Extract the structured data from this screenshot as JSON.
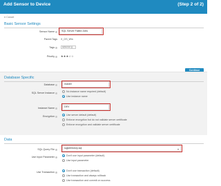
{
  "header": {
    "title": "Add Sensor to Device",
    "step": "(Step 2 of 2)"
  },
  "cancel_label": "Cancel",
  "basic": {
    "title": "Basic Sensor Settings",
    "sensor_name_label": "Sensor Name",
    "sensor_name_value": "SQL Server Failed Jobs",
    "parent_tags_label": "Parent Tags",
    "parent_tags_value": "X_OS_Win",
    "tags_label": "Tags",
    "tags_chip": "sqlserver",
    "priority_label": "Priority",
    "priority_value": 3,
    "priority_stars": "★★★☆☆"
  },
  "continue_label": "Continue",
  "database": {
    "title": "Database Specific",
    "database_label": "Database",
    "database_value": "master",
    "instance_label": "SQL Server Instance",
    "instance_options": [
      "No instance name required (default)",
      "Use instance name"
    ],
    "instance_selected": 1,
    "instance_name_label": "Instance Name",
    "instance_name_value": "DEV",
    "encryption_label": "Encryption",
    "encryption_options": [
      "Use server default (default)",
      "Enforce encryption but do not validate server certificate",
      "Enforce encryption and validate server certificate"
    ],
    "encryption_selected": 0
  },
  "data": {
    "title": "Data",
    "query_file_label": "SQL Query File",
    "query_file_value": "sqljobhistory.sql",
    "input_param_label": "Use Input Parameter",
    "input_param_options": [
      "Don't use input parameter (default)",
      "Use input parameter"
    ],
    "input_param_selected": 0,
    "transaction_label": "Use Transaction",
    "transaction_options": [
      "Don't use transaction (default)",
      "Use transaction and always rollback",
      "Use transaction and commit on success"
    ],
    "transaction_selected": 0
  },
  "colors": {
    "header": "#1f8ac0",
    "highlight": "#c9302c"
  }
}
